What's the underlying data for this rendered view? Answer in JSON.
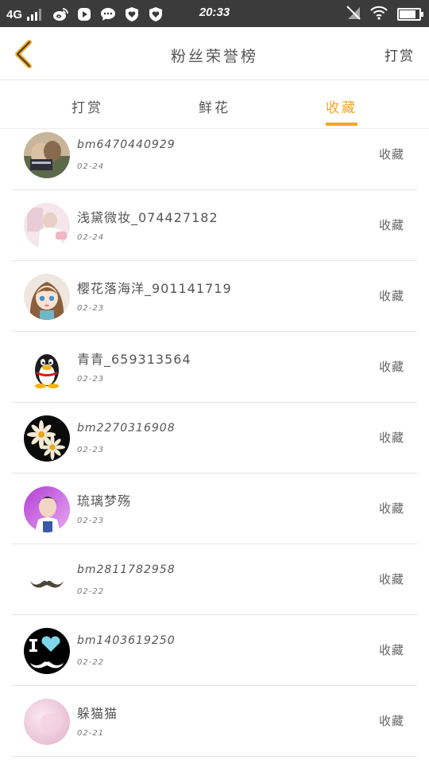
{
  "status_bar": {
    "network": "4G",
    "time": "20:33",
    "battery_level": 0.9,
    "app_icons": [
      "weibo-icon",
      "play-icon",
      "message-icon",
      "shield-heart-icon",
      "shield-heart-icon"
    ],
    "right_icons": [
      "mute-icon",
      "wifi-icon",
      "battery-icon"
    ]
  },
  "navbar": {
    "title": "粉丝荣誉榜",
    "action_label": "打赏"
  },
  "tabs": [
    {
      "label": "打赏",
      "active": false
    },
    {
      "label": "鲜花",
      "active": false
    },
    {
      "label": "收藏",
      "active": true
    }
  ],
  "accent_color": "#f5a623",
  "list": [
    {
      "name": "bm6470440929",
      "date": "02-24",
      "action": "收藏",
      "avatar": "photo-couple"
    },
    {
      "name": "浅黛微妆_074427182",
      "date": "02-24",
      "action": "收藏",
      "avatar": "photo-pink-room"
    },
    {
      "name": "樱花落海洋_901141719",
      "date": "02-23",
      "action": "收藏",
      "avatar": "anime-girl"
    },
    {
      "name": "青青_659313564",
      "date": "02-23",
      "action": "收藏",
      "avatar": "penguin"
    },
    {
      "name": "bm2270316908",
      "date": "02-23",
      "action": "收藏",
      "avatar": "daisies"
    },
    {
      "name": "琉璃梦殇",
      "date": "02-23",
      "action": "收藏",
      "avatar": "boy-photo"
    },
    {
      "name": "bm2811782958",
      "date": "02-22",
      "action": "收藏",
      "avatar": "mustache"
    },
    {
      "name": "bm1403619250",
      "date": "02-22",
      "action": "收藏",
      "avatar": "i-love-mustache"
    },
    {
      "name": "躲猫猫",
      "date": "02-21",
      "action": "收藏",
      "avatar": "pink-blur"
    }
  ]
}
